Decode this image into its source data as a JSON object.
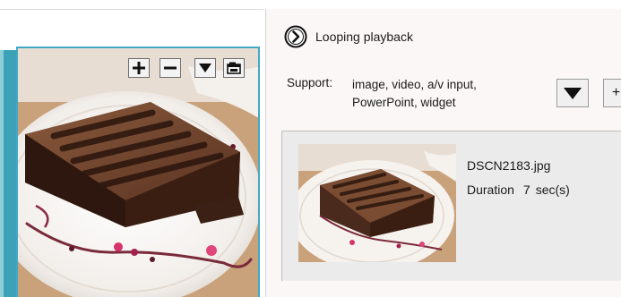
{
  "preview": {
    "toolbar": {
      "zoom_in_icon": "plus-icon",
      "zoom_out_icon": "minus-icon",
      "dropdown_icon": "triangle-down-icon",
      "window_icon": "window-icon"
    },
    "image_subject": "chocolate cake slice on white plate"
  },
  "playback": {
    "icon": "chevron-right-circle-icon",
    "label": "Looping playback"
  },
  "support": {
    "label": "Support:",
    "line1": "image, video, a/v input,",
    "line2": "PowerPoint, widget",
    "dropdown_icon": "triangle-down-icon",
    "add_label": "+"
  },
  "playlist": {
    "items": [
      {
        "filename": "DSCN2183.jpg",
        "duration_label": "Duration",
        "duration_value": "7",
        "duration_unit": "sec(s)"
      }
    ]
  },
  "colors": {
    "accent_blue": "#41a9c4",
    "panel_bg": "#fcf7f7",
    "item_bg": "#ebebeb"
  }
}
